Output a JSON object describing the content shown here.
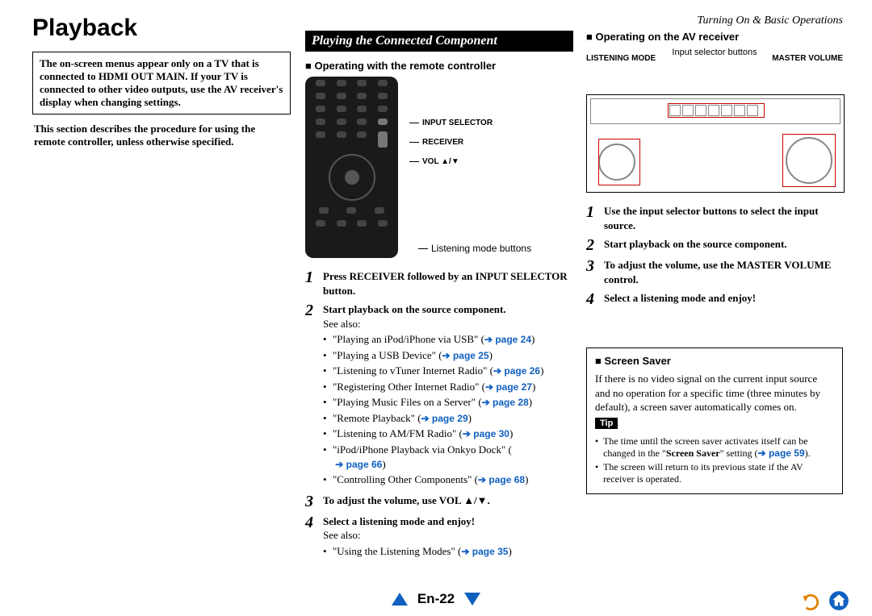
{
  "header": {
    "section": "Turning On & Basic Operations",
    "title": "Playback",
    "pagenum": "En-22"
  },
  "col1": {
    "note1_a": "The on-screen menus appear only on a TV that is connected to ",
    "note1_b": "HDMI OUT MAIN.",
    "note1_c": " If your TV is connected to other video outputs, use the AV receiver's display when changing settings.",
    "note2": "This section describes the procedure for using the remote controller, unless otherwise specified."
  },
  "col2": {
    "bar": "Playing the Connected Component",
    "sh1": "Operating with the remote controller",
    "labels": {
      "sel": "INPUT SELECTOR",
      "rcv": "RECEIVER",
      "vol": "VOL ▲/▼",
      "lm": "Listening mode buttons"
    },
    "steps": [
      {
        "n": "1",
        "lead_a": "Press ",
        "lead_b": "RECEIVER",
        "lead_c": " followed by an ",
        "lead_d": "INPUT SELECTOR",
        "lead_e": " button."
      },
      {
        "n": "2",
        "lead": "Start playback on the source component.",
        "extra": "See also:",
        "subs": [
          {
            "t": "\"Playing an iPod/iPhone via USB\" (",
            "p": "page 24"
          },
          {
            "t": "\"Playing a USB Device\" (",
            "p": "page 25"
          },
          {
            "t": "\"Listening to vTuner Internet Radio\" (",
            "p": "page 26"
          },
          {
            "t": "\"Registering Other Internet Radio\" (",
            "p": "page 27"
          },
          {
            "t": "\"Playing Music Files on a Server\" (",
            "p": "page 28"
          },
          {
            "t": "\"Remote Playback\" (",
            "p": "page 29"
          },
          {
            "t": "\"Listening to AM/FM Radio\" (",
            "p": "page 30"
          },
          {
            "t": "\"iPod/iPhone Playback via Onkyo Dock\" (",
            "p": "page 66"
          },
          {
            "t": "\"Controlling Other Components\" (",
            "p": "page 68"
          }
        ]
      },
      {
        "n": "3",
        "lead_a": "To adjust the volume, use ",
        "lead_b": "VOL ▲/▼",
        "lead_c": "."
      },
      {
        "n": "4",
        "lead": "Select a listening mode and enjoy!",
        "extra": "See also:",
        "subs": [
          {
            "t": "\"Using the Listening Modes\" (",
            "p": "page 35"
          }
        ]
      }
    ]
  },
  "col3": {
    "sh1": "Operating on the AV receiver",
    "diag": {
      "input": "Input selector buttons",
      "lm": "LISTENING MODE",
      "mv": "MASTER VOLUME"
    },
    "steps": [
      {
        "n": "1",
        "lead": "Use the input selector buttons to select the input source."
      },
      {
        "n": "2",
        "lead": "Start playback on the source component."
      },
      {
        "n": "3",
        "lead_a": "To adjust the volume, use the ",
        "lead_b": "MASTER VOLUME",
        "lead_c": " control."
      },
      {
        "n": "4",
        "lead": "Select a listening mode and enjoy!"
      }
    ],
    "saver": {
      "h": "Screen Saver",
      "body": "If there is no video signal on the current input source and no operation for a specific time (three minutes by default), a screen saver automatically comes on.",
      "tip": "Tip",
      "n1_a": "The time until the screen saver activates itself can be changed in the \"",
      "n1_b": "Screen Saver",
      "n1_c": "\" setting (",
      "n1_p": "page 59",
      "n1_d": ").",
      "n2": "The screen will return to its previous state if the AV receiver is operated."
    }
  }
}
